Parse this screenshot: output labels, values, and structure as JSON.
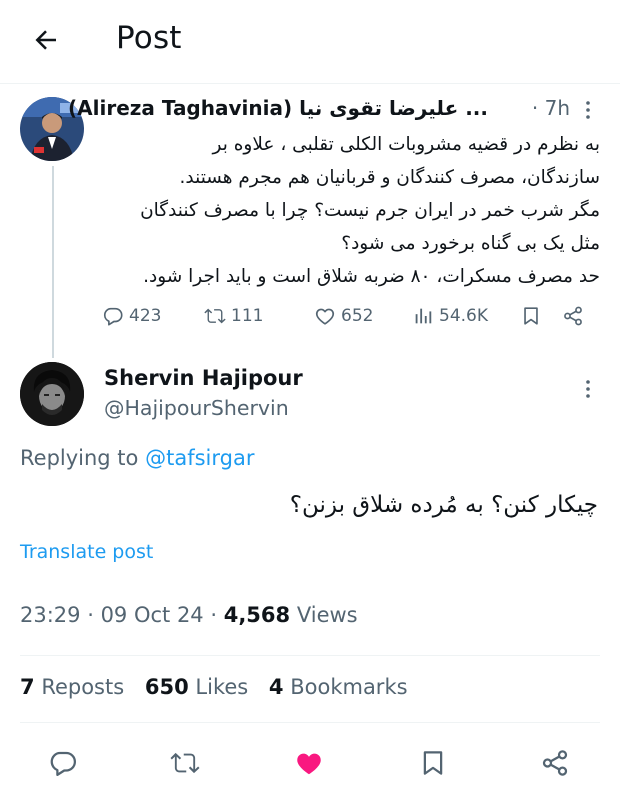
{
  "header": {
    "title": "Post"
  },
  "quoted_post": {
    "author_name": "(Alireza Taghavinia) علیرضا تقوی نیا ...",
    "time": "· 7h",
    "lines": [
      "به نظرم در قضیه مشروبات الکلی تقلبی ، علاوه بر",
      "سازندگان، مصرف کنندگان و قربانیان هم مجرم هستند.",
      "مگر شرب خمر در ایران جرم نیست؟ چرا با مصرف کنندگان",
      "مثل یک بی گناه برخورد می شود؟",
      "حد مصرف مسکرات، ۸۰ ضربه شلاق است و باید اجرا شود."
    ],
    "replies": "423",
    "reposts": "111",
    "likes": "652",
    "views": "54.6K"
  },
  "post": {
    "author_name": "Shervin Hajipour",
    "handle": "@HajipourShervin",
    "replying_prefix": "Replying to",
    "replying_to": "@tafsirgar",
    "text": "چیکار کنن؟ به مُرده شلاق بزنن؟",
    "translate_label": "Translate post",
    "time": "23:29",
    "date": "09 Oct 24",
    "views_count": "4,568",
    "views_label": "Views",
    "reposts_count": "7",
    "reposts_label": "Reposts",
    "likes_count": "650",
    "likes_label": "Likes",
    "bookmarks_count": "4",
    "bookmarks_label": "Bookmarks"
  },
  "colors": {
    "accent": "#1d9bf0",
    "like_active": "#f91880",
    "secondary_text": "#536471"
  },
  "icons": {
    "back": "arrow-left-icon",
    "reply": "speech-bubble-icon",
    "repost": "repost-arrows-icon",
    "like": "heart-icon",
    "views": "bar-chart-icon",
    "bookmark": "bookmark-icon",
    "share": "share-nodes-icon",
    "more": "vertical-dots-icon"
  }
}
